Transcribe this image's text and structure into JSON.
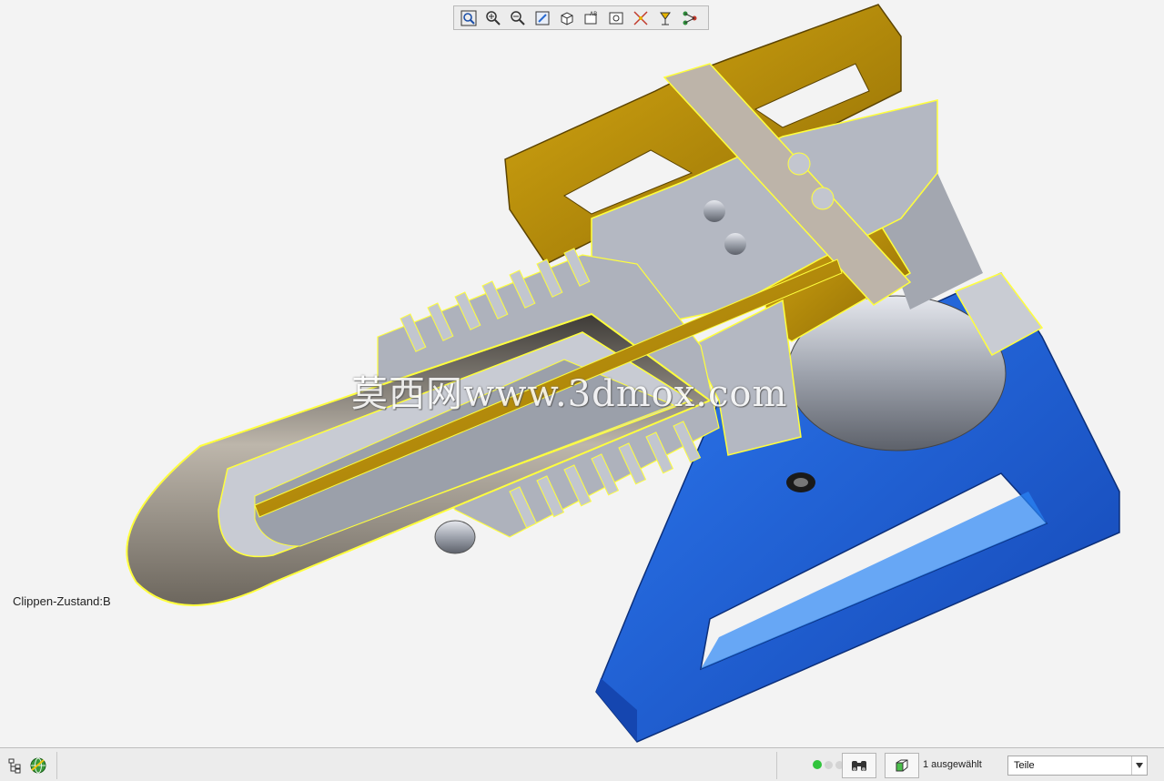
{
  "viewport": {
    "clip_state_label": "Clippen-Zustand:B",
    "watermark": "莫西网www.3dmox.com"
  },
  "toolbar": {
    "tools": [
      {
        "name": "zoom-fit-icon"
      },
      {
        "name": "zoom-in-icon"
      },
      {
        "name": "zoom-out-icon"
      },
      {
        "name": "repaint-icon"
      },
      {
        "name": "display-style-icon"
      },
      {
        "name": "saved-views-icon"
      },
      {
        "name": "view-manager-icon"
      },
      {
        "name": "datum-display-icon"
      },
      {
        "name": "annotation-display-icon"
      },
      {
        "name": "spin-center-icon"
      }
    ]
  },
  "statusbar": {
    "selection_count": "1 ausgewählt",
    "filter_value": "Teile"
  },
  "colors": {
    "blue_part": "#1f5fd6",
    "gold_part": "#c89a0a",
    "gray_section": "#b8bcc6",
    "section_edge": "#ffff3c",
    "status_green": "#31c43c"
  }
}
